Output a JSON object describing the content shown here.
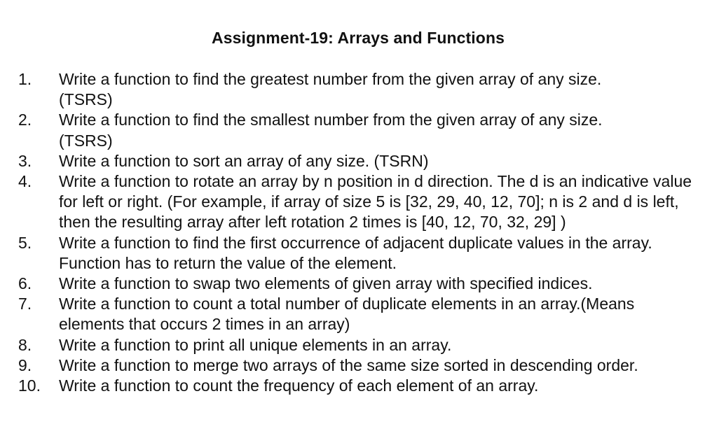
{
  "document": {
    "title": "Assignment-19: Arrays and Functions",
    "items": [
      {
        "number": "1.",
        "text": "Write a function to find the greatest number from the given array of any size. (TSRS)"
      },
      {
        "number": "2.",
        "text": "Write a function to find the smallest number from the given array of any size. (TSRS)"
      },
      {
        "number": "3.",
        "text": "Write a function to sort an array of any size. (TSRN)"
      },
      {
        "number": "4.",
        "text": "Write a function to rotate an array by n position in d direction. The d is an indicative value for left or right. (For example, if array of size 5 is [32, 29, 40, 12, 70]; n is 2 and d is left, then the resulting array after left rotation 2 times is [40, 12, 70, 32, 29] )"
      },
      {
        "number": "5.",
        "text": "Write a function to find the first occurrence of adjacent duplicate values in the array. Function has to return the value of the element."
      },
      {
        "number": "6.",
        "text": "Write a function to swap two elements of given array with specified indices."
      },
      {
        "number": "7.",
        "text": "Write a function to count a total number of duplicate elements in an array.(Means elements that occurs 2 times in an array)"
      },
      {
        "number": "8.",
        "text": "Write a function to print all unique elements in an array."
      },
      {
        "number": "9.",
        "text": "Write a function to merge two arrays of the same size sorted in descending order."
      },
      {
        "number": "10.",
        "text": "Write a function to count the frequency of each element of an array."
      }
    ]
  }
}
